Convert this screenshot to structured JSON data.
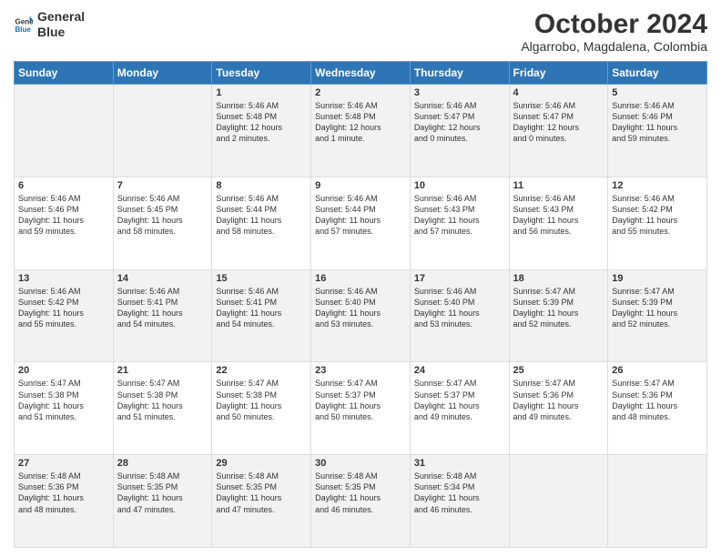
{
  "header": {
    "logo_line1": "General",
    "logo_line2": "Blue",
    "main_title": "October 2024",
    "subtitle": "Algarrobo, Magdalena, Colombia"
  },
  "days_of_week": [
    "Sunday",
    "Monday",
    "Tuesday",
    "Wednesday",
    "Thursday",
    "Friday",
    "Saturday"
  ],
  "weeks": [
    [
      {
        "day": "",
        "text": ""
      },
      {
        "day": "",
        "text": ""
      },
      {
        "day": "1",
        "text": "Sunrise: 5:46 AM\nSunset: 5:48 PM\nDaylight: 12 hours\nand 2 minutes."
      },
      {
        "day": "2",
        "text": "Sunrise: 5:46 AM\nSunset: 5:48 PM\nDaylight: 12 hours\nand 1 minute."
      },
      {
        "day": "3",
        "text": "Sunrise: 5:46 AM\nSunset: 5:47 PM\nDaylight: 12 hours\nand 0 minutes."
      },
      {
        "day": "4",
        "text": "Sunrise: 5:46 AM\nSunset: 5:47 PM\nDaylight: 12 hours\nand 0 minutes."
      },
      {
        "day": "5",
        "text": "Sunrise: 5:46 AM\nSunset: 5:46 PM\nDaylight: 11 hours\nand 59 minutes."
      }
    ],
    [
      {
        "day": "6",
        "text": "Sunrise: 5:46 AM\nSunset: 5:46 PM\nDaylight: 11 hours\nand 59 minutes."
      },
      {
        "day": "7",
        "text": "Sunrise: 5:46 AM\nSunset: 5:45 PM\nDaylight: 11 hours\nand 58 minutes."
      },
      {
        "day": "8",
        "text": "Sunrise: 5:46 AM\nSunset: 5:44 PM\nDaylight: 11 hours\nand 58 minutes."
      },
      {
        "day": "9",
        "text": "Sunrise: 5:46 AM\nSunset: 5:44 PM\nDaylight: 11 hours\nand 57 minutes."
      },
      {
        "day": "10",
        "text": "Sunrise: 5:46 AM\nSunset: 5:43 PM\nDaylight: 11 hours\nand 57 minutes."
      },
      {
        "day": "11",
        "text": "Sunrise: 5:46 AM\nSunset: 5:43 PM\nDaylight: 11 hours\nand 56 minutes."
      },
      {
        "day": "12",
        "text": "Sunrise: 5:46 AM\nSunset: 5:42 PM\nDaylight: 11 hours\nand 55 minutes."
      }
    ],
    [
      {
        "day": "13",
        "text": "Sunrise: 5:46 AM\nSunset: 5:42 PM\nDaylight: 11 hours\nand 55 minutes."
      },
      {
        "day": "14",
        "text": "Sunrise: 5:46 AM\nSunset: 5:41 PM\nDaylight: 11 hours\nand 54 minutes."
      },
      {
        "day": "15",
        "text": "Sunrise: 5:46 AM\nSunset: 5:41 PM\nDaylight: 11 hours\nand 54 minutes."
      },
      {
        "day": "16",
        "text": "Sunrise: 5:46 AM\nSunset: 5:40 PM\nDaylight: 11 hours\nand 53 minutes."
      },
      {
        "day": "17",
        "text": "Sunrise: 5:46 AM\nSunset: 5:40 PM\nDaylight: 11 hours\nand 53 minutes."
      },
      {
        "day": "18",
        "text": "Sunrise: 5:47 AM\nSunset: 5:39 PM\nDaylight: 11 hours\nand 52 minutes."
      },
      {
        "day": "19",
        "text": "Sunrise: 5:47 AM\nSunset: 5:39 PM\nDaylight: 11 hours\nand 52 minutes."
      }
    ],
    [
      {
        "day": "20",
        "text": "Sunrise: 5:47 AM\nSunset: 5:38 PM\nDaylight: 11 hours\nand 51 minutes."
      },
      {
        "day": "21",
        "text": "Sunrise: 5:47 AM\nSunset: 5:38 PM\nDaylight: 11 hours\nand 51 minutes."
      },
      {
        "day": "22",
        "text": "Sunrise: 5:47 AM\nSunset: 5:38 PM\nDaylight: 11 hours\nand 50 minutes."
      },
      {
        "day": "23",
        "text": "Sunrise: 5:47 AM\nSunset: 5:37 PM\nDaylight: 11 hours\nand 50 minutes."
      },
      {
        "day": "24",
        "text": "Sunrise: 5:47 AM\nSunset: 5:37 PM\nDaylight: 11 hours\nand 49 minutes."
      },
      {
        "day": "25",
        "text": "Sunrise: 5:47 AM\nSunset: 5:36 PM\nDaylight: 11 hours\nand 49 minutes."
      },
      {
        "day": "26",
        "text": "Sunrise: 5:47 AM\nSunset: 5:36 PM\nDaylight: 11 hours\nand 48 minutes."
      }
    ],
    [
      {
        "day": "27",
        "text": "Sunrise: 5:48 AM\nSunset: 5:36 PM\nDaylight: 11 hours\nand 48 minutes."
      },
      {
        "day": "28",
        "text": "Sunrise: 5:48 AM\nSunset: 5:35 PM\nDaylight: 11 hours\nand 47 minutes."
      },
      {
        "day": "29",
        "text": "Sunrise: 5:48 AM\nSunset: 5:35 PM\nDaylight: 11 hours\nand 47 minutes."
      },
      {
        "day": "30",
        "text": "Sunrise: 5:48 AM\nSunset: 5:35 PM\nDaylight: 11 hours\nand 46 minutes."
      },
      {
        "day": "31",
        "text": "Sunrise: 5:48 AM\nSunset: 5:34 PM\nDaylight: 11 hours\nand 46 minutes."
      },
      {
        "day": "",
        "text": ""
      },
      {
        "day": "",
        "text": ""
      }
    ]
  ]
}
